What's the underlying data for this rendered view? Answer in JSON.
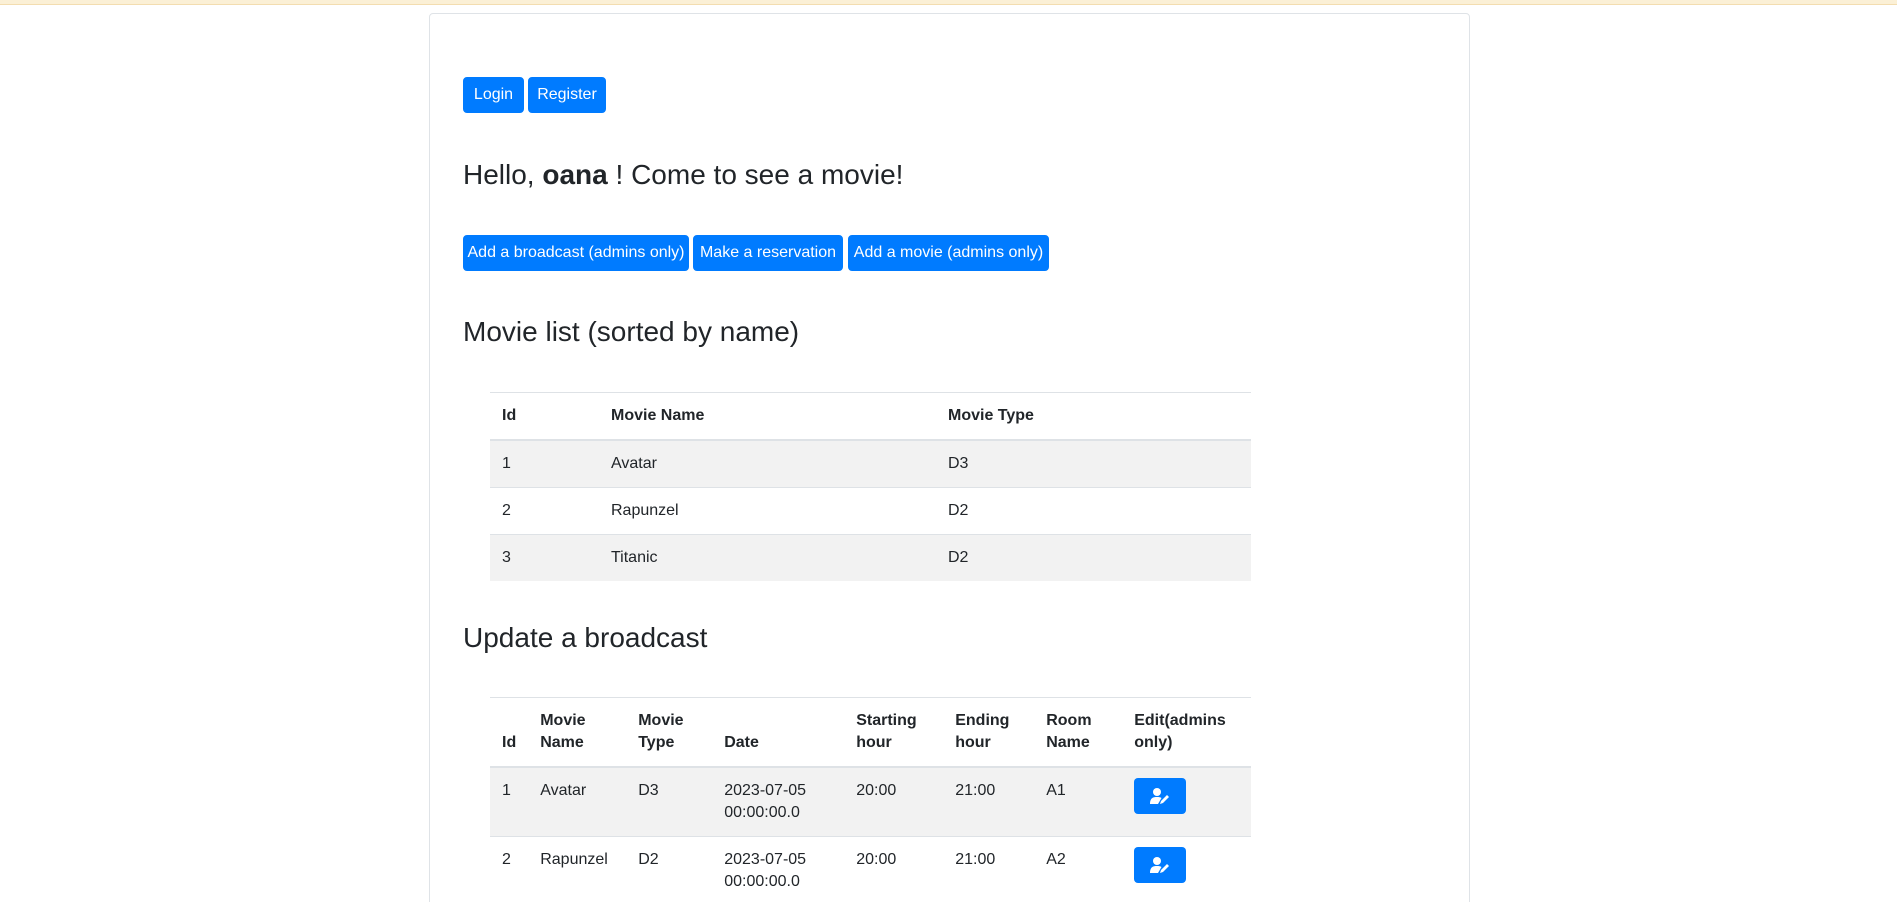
{
  "header": {
    "login_label": "Login",
    "register_label": "Register"
  },
  "greeting": {
    "prefix": "Hello,",
    "username": "oana",
    "suffix": "! Come to see a movie!"
  },
  "actions": {
    "add_broadcast_label": "Add a broadcast (admins only)",
    "make_reservation_label": "Make a reservation",
    "add_movie_label": "Add a movie (admins only)"
  },
  "movie_list": {
    "title": "Movie list (sorted by name)",
    "columns": [
      "Id",
      "Movie Name",
      "Movie Type"
    ],
    "rows": [
      [
        "1",
        "Avatar",
        "D3"
      ],
      [
        "2",
        "Rapunzel",
        "D2"
      ],
      [
        "3",
        "Titanic",
        "D2"
      ]
    ]
  },
  "broadcasts": {
    "title": "Update a broadcast",
    "columns": [
      "Id",
      "Movie Name",
      "Movie Type",
      "Date",
      "Starting hour",
      "Ending hour",
      "Room Name",
      "Edit(admins only)"
    ],
    "rows": [
      [
        "1",
        "Avatar",
        "D3",
        "2023-07-05 00:00:00.0",
        "20:00",
        "21:00",
        "A1"
      ],
      [
        "2",
        "Rapunzel",
        "D2",
        "2023-07-05 00:00:00.0",
        "20:00",
        "21:00",
        "A2"
      ]
    ],
    "edit_icon": "user-edit-icon"
  },
  "colors": {
    "primary": "#007bff",
    "stripe": "#f2f2f2",
    "text": "#212529"
  }
}
